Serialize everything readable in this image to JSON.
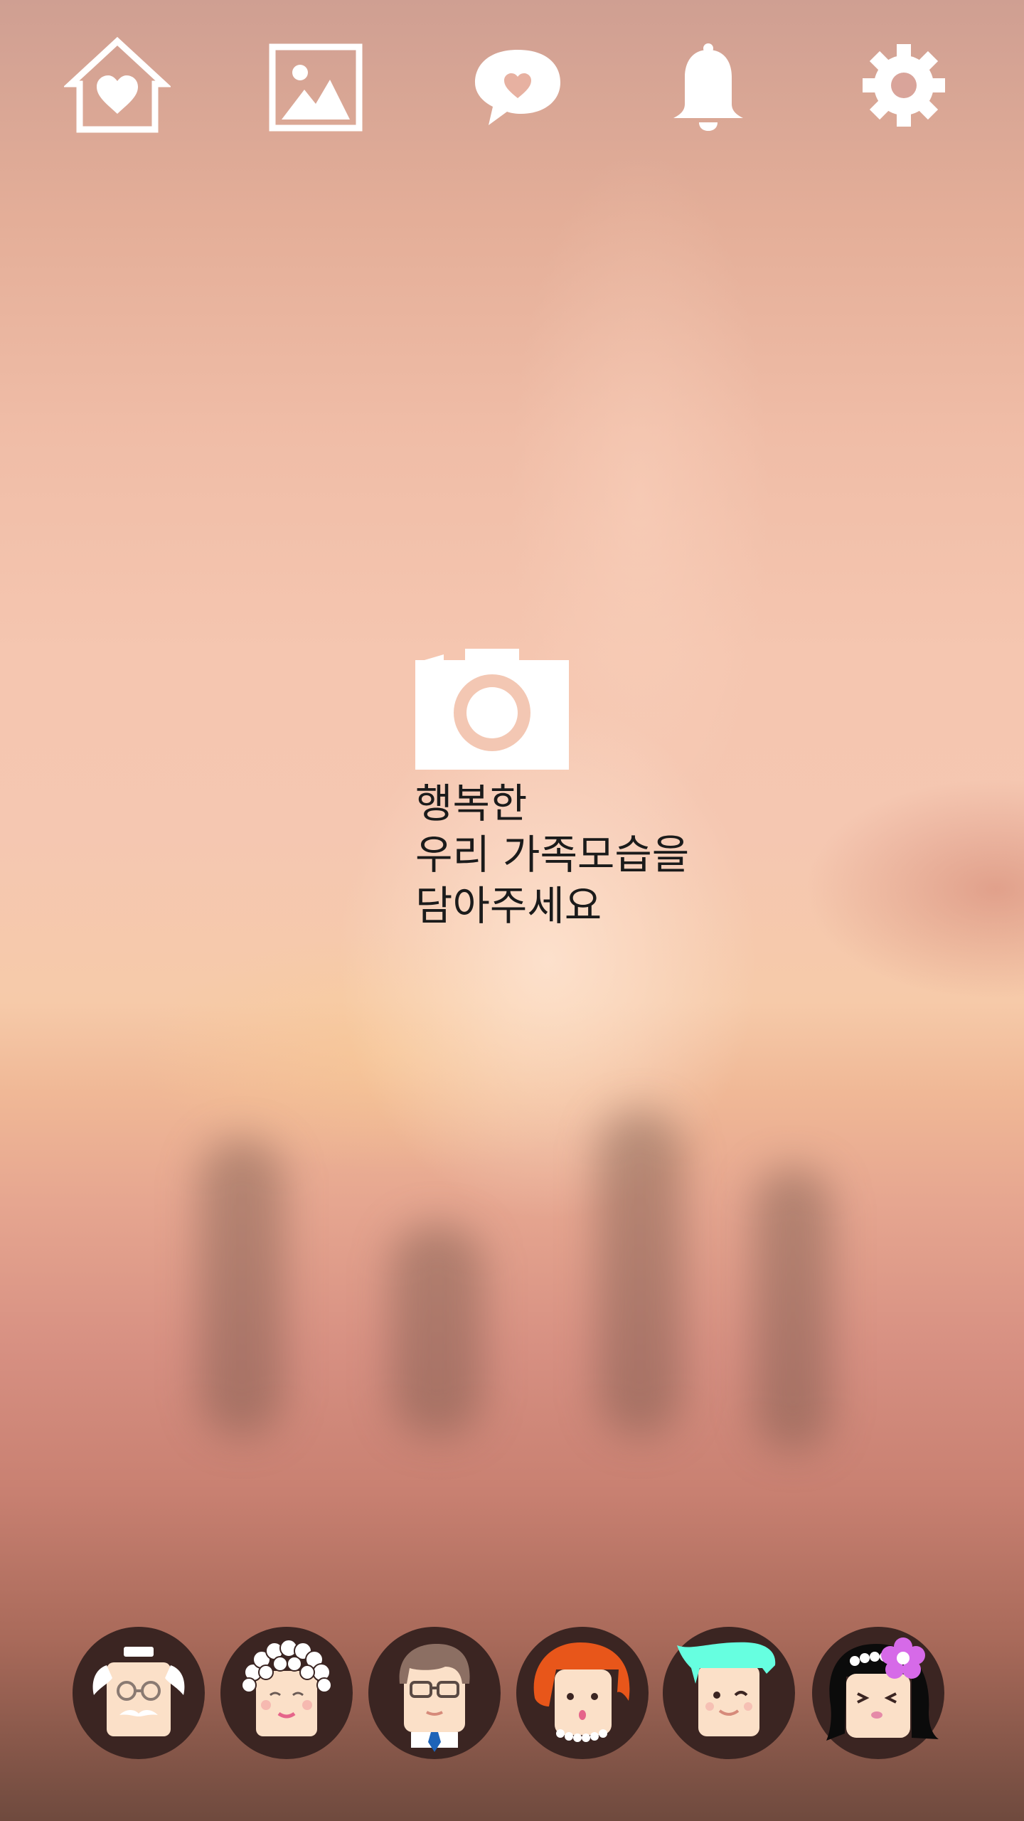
{
  "top_nav": {
    "icons": [
      {
        "name": "home-heart-icon"
      },
      {
        "name": "gallery-icon"
      },
      {
        "name": "message-heart-icon"
      },
      {
        "name": "notification-bell-icon"
      },
      {
        "name": "settings-gear-icon"
      }
    ],
    "icon_color": "#ffffff"
  },
  "main": {
    "camera_icon": "camera-icon",
    "prompt_lines": [
      "행복한",
      "우리 가족모습을",
      "담아주세요"
    ]
  },
  "family_members": [
    {
      "name": "grandfather-avatar"
    },
    {
      "name": "grandmother-avatar"
    },
    {
      "name": "father-avatar"
    },
    {
      "name": "mother-avatar"
    },
    {
      "name": "son-avatar"
    },
    {
      "name": "daughter-avatar"
    }
  ],
  "colors": {
    "avatar_ring": "#3b2522",
    "skin": "#fbe0c8",
    "text": "#1b1b1b"
  }
}
